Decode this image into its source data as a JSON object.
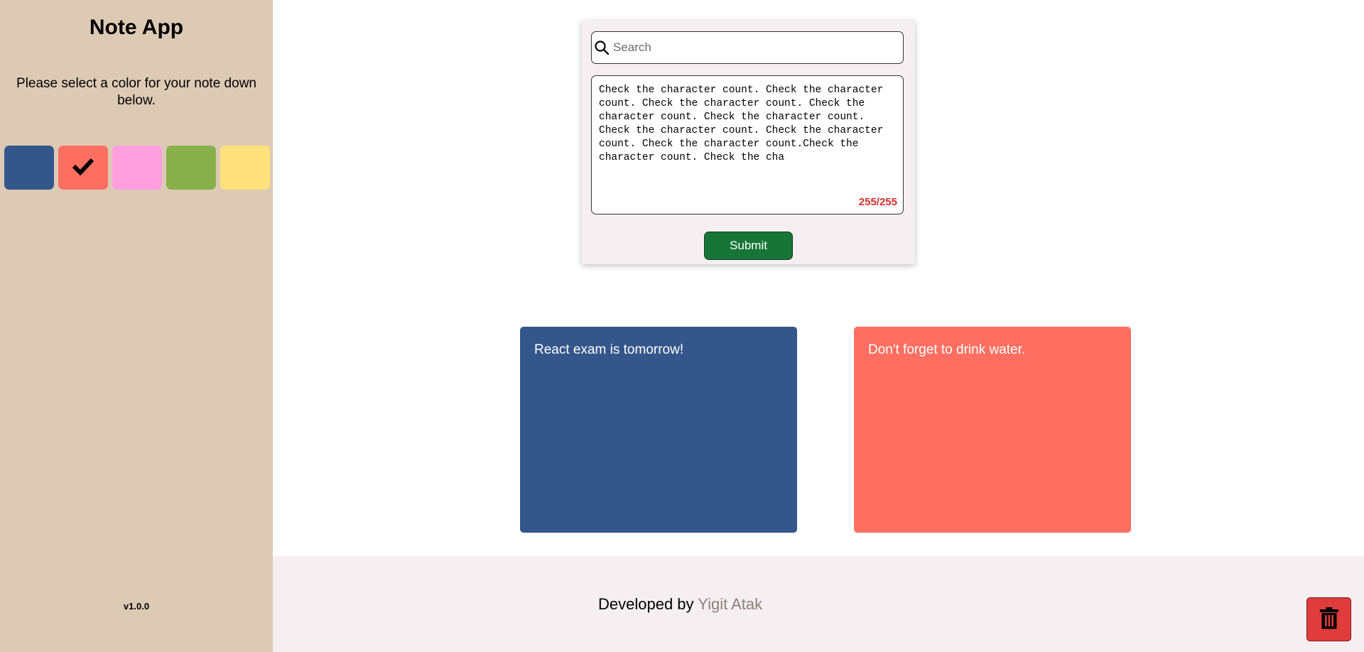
{
  "sidebar": {
    "title": "Note App",
    "instructions": "Please select a color for your note down below.",
    "colors": [
      "#34568b",
      "#ff6f61",
      "#ff9fe0",
      "#88b04b",
      "#ffe17b"
    ],
    "selected_color_index": 1,
    "version": "v1.0.0"
  },
  "form": {
    "search_placeholder": "Search",
    "note_text": "Check the character count. Check the character count. Check the character count. Check the character count. Check the character count. Check the character count. Check the character count. Check the character count.Check the character count. Check the cha",
    "char_count": "255/255",
    "submit_label": "Submit"
  },
  "notes": [
    {
      "text": "React exam is tomorrow!",
      "color": "#34568b"
    },
    {
      "text": "Don't forget to drink water.",
      "color": "#ff6f61"
    }
  ],
  "footer": {
    "prefix": "Developed by ",
    "author": "Yigit Atak"
  }
}
